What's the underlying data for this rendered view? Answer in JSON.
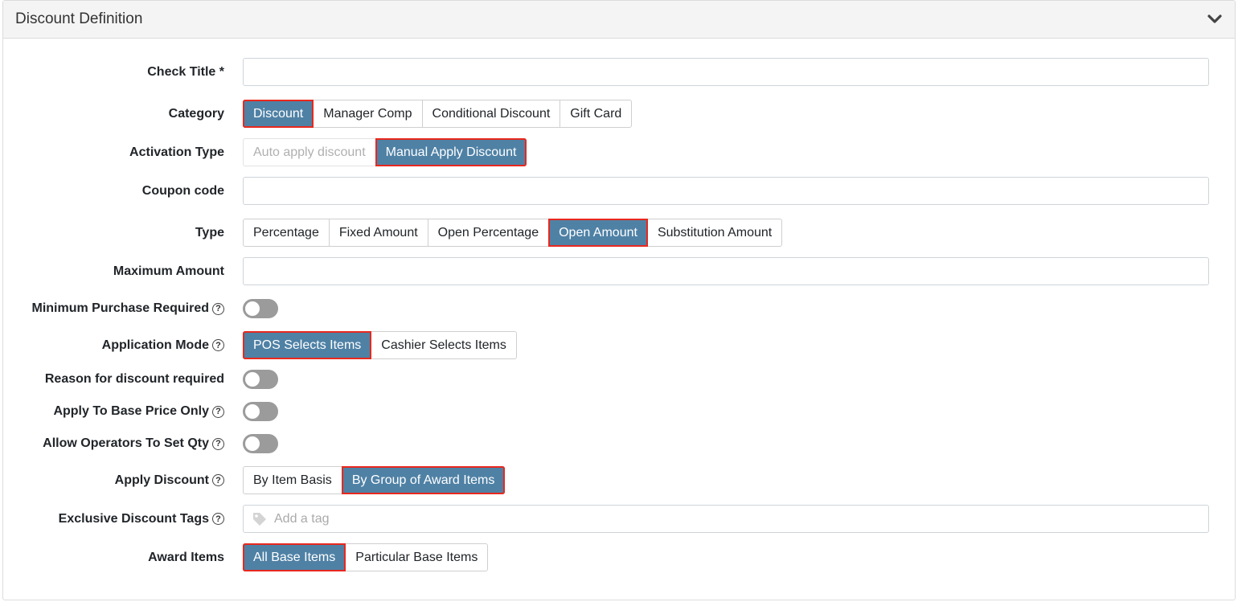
{
  "panel": {
    "title": "Discount Definition"
  },
  "fields": {
    "check_title": {
      "label": "Check Title *",
      "value": ""
    },
    "category": {
      "label": "Category",
      "options": [
        "Discount",
        "Manager Comp",
        "Conditional Discount",
        "Gift Card"
      ],
      "selected": "Discount"
    },
    "activation_type": {
      "label": "Activation Type",
      "options": [
        "Auto apply discount",
        "Manual Apply Discount"
      ],
      "selected": "Manual Apply Discount"
    },
    "coupon_code": {
      "label": "Coupon code",
      "value": ""
    },
    "type": {
      "label": "Type",
      "options": [
        "Percentage",
        "Fixed Amount",
        "Open Percentage",
        "Open Amount",
        "Substitution Amount"
      ],
      "selected": "Open Amount"
    },
    "maximum_amount": {
      "label": "Maximum Amount",
      "value": ""
    },
    "minimum_purchase": {
      "label": "Minimum Purchase Required",
      "enabled": false
    },
    "application_mode": {
      "label": "Application Mode",
      "options": [
        "POS Selects Items",
        "Cashier Selects Items"
      ],
      "selected": "POS Selects Items"
    },
    "reason_required": {
      "label": "Reason for discount required",
      "enabled": false
    },
    "apply_base_price": {
      "label": "Apply To Base Price Only",
      "enabled": false
    },
    "allow_set_qty": {
      "label": "Allow Operators To Set Qty",
      "enabled": false
    },
    "apply_discount": {
      "label": "Apply Discount",
      "options": [
        "By Item Basis",
        "By Group of Award Items"
      ],
      "selected": "By Group of Award Items"
    },
    "exclusive_tags": {
      "label": "Exclusive Discount Tags",
      "placeholder": "Add a tag"
    },
    "award_items": {
      "label": "Award Items",
      "options": [
        "All Base Items",
        "Particular Base Items"
      ],
      "selected": "All Base Items"
    }
  },
  "help_glyph": "?",
  "colors": {
    "active": "#4f81a5",
    "highlight": "#e8281e",
    "toggle_off": "#9b9b9b"
  }
}
